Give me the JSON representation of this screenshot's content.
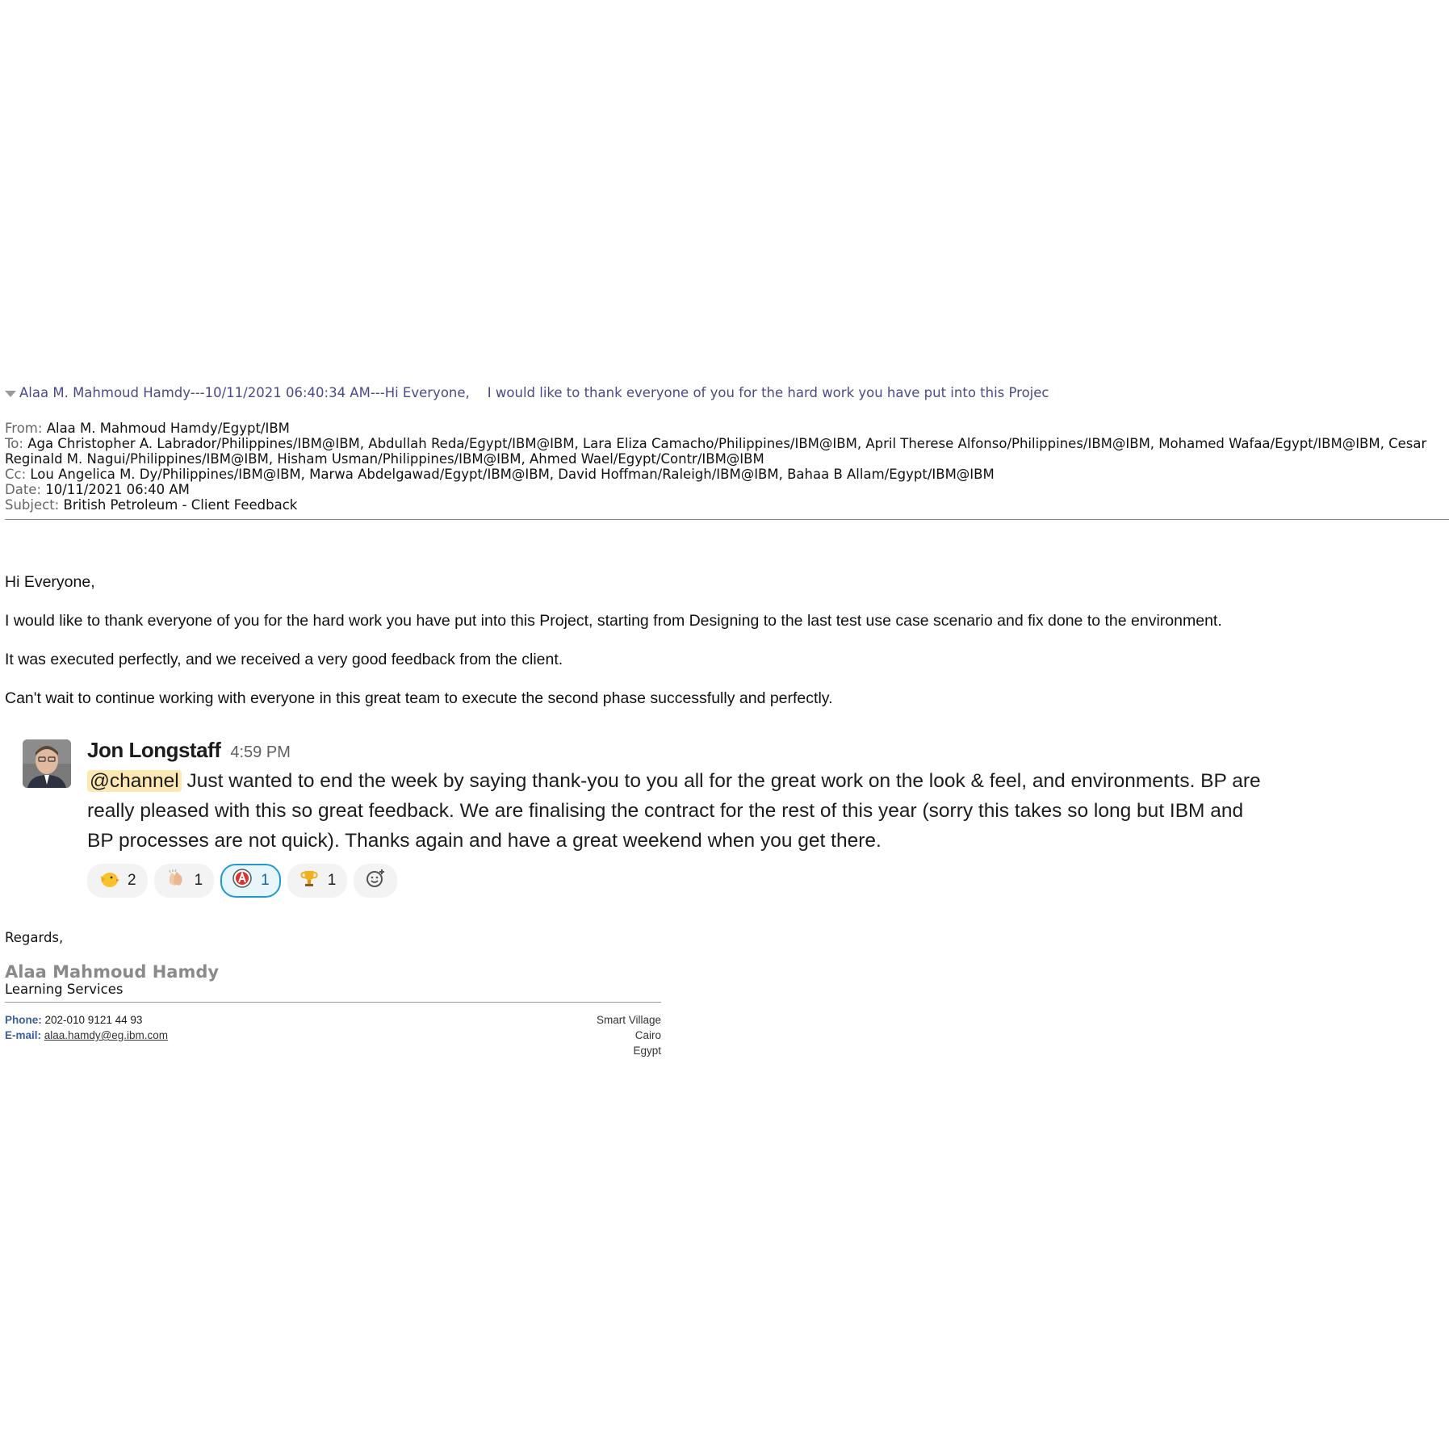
{
  "thread": {
    "summary": "Alaa M. Mahmoud Hamdy---10/11/2021 06:40:34 AM---Hi Everyone,",
    "preview": "I would like to thank everyone of you for the hard work you have put into this Projec"
  },
  "headers": {
    "from_label": "From:",
    "from": "Alaa M. Mahmoud Hamdy/Egypt/IBM",
    "to_label": "To:",
    "to": "Aga Christopher A. Labrador/Philippines/IBM@IBM, Abdullah Reda/Egypt/IBM@IBM, Lara Eliza Camacho/Philippines/IBM@IBM, April Therese Alfonso/Philippines/IBM@IBM, Mohamed Wafaa/Egypt/IBM@IBM, Cesar Reginald M. Nagui/Philippines/IBM@IBM, Hisham Usman/Philippines/IBM@IBM, Ahmed Wael/Egypt/Contr/IBM@IBM",
    "cc_label": "Cc:",
    "cc": "Lou Angelica M. Dy/Philippines/IBM@IBM, Marwa Abdelgawad/Egypt/IBM@IBM, David Hoffman/Raleigh/IBM@IBM, Bahaa B Allam/Egypt/IBM@IBM",
    "date_label": "Date:",
    "date": "10/11/2021 06:40 AM",
    "subject_label": "Subject:",
    "subject": "British Petroleum - Client Feedback"
  },
  "body": {
    "greeting": "Hi Everyone,",
    "p1": "I would like to thank everyone of you for the hard work you have put into this Project, starting from Designing to the last test use case scenario and fix done to the environment.",
    "p2": "It was executed perfectly, and we received a very good feedback from the client.",
    "p3": "Can't wait to continue working with everyone in this great team to execute the second phase successfully and perfectly."
  },
  "slack": {
    "author": "Jon Longstaff",
    "time": "4:59 PM",
    "mention": "@channel",
    "message": " Just wanted to end the week by saying thank-you to you all for the great work on the look & feel, and  environments. BP are really pleased with this so great feedback. We are finalising the contract for the rest of this year (sorry this takes so long but IBM and BP processes are not quick). Thanks again and have a great weekend when you get there.",
    "reactions": [
      {
        "icon": "clap-chick-emoji",
        "count": "2",
        "active": false
      },
      {
        "icon": "clapping-hands-emoji",
        "count": "1",
        "active": false
      },
      {
        "icon": "a-badge-emoji",
        "count": "1",
        "active": true
      },
      {
        "icon": "trophy-emoji",
        "count": "1",
        "active": false
      }
    ],
    "add_reaction_icon": "add-reaction-icon"
  },
  "signature": {
    "regards": "Regards,",
    "name": "Alaa Mahmoud Hamdy",
    "dept": "Learning Services",
    "phone_label": "Phone:",
    "phone": "202-010 9121 44 93",
    "email_label": "E-mail:",
    "email": "alaa.hamdy@eg.ibm.com",
    "address1": "Smart Village",
    "address2": "Cairo",
    "address3": "Egypt"
  }
}
